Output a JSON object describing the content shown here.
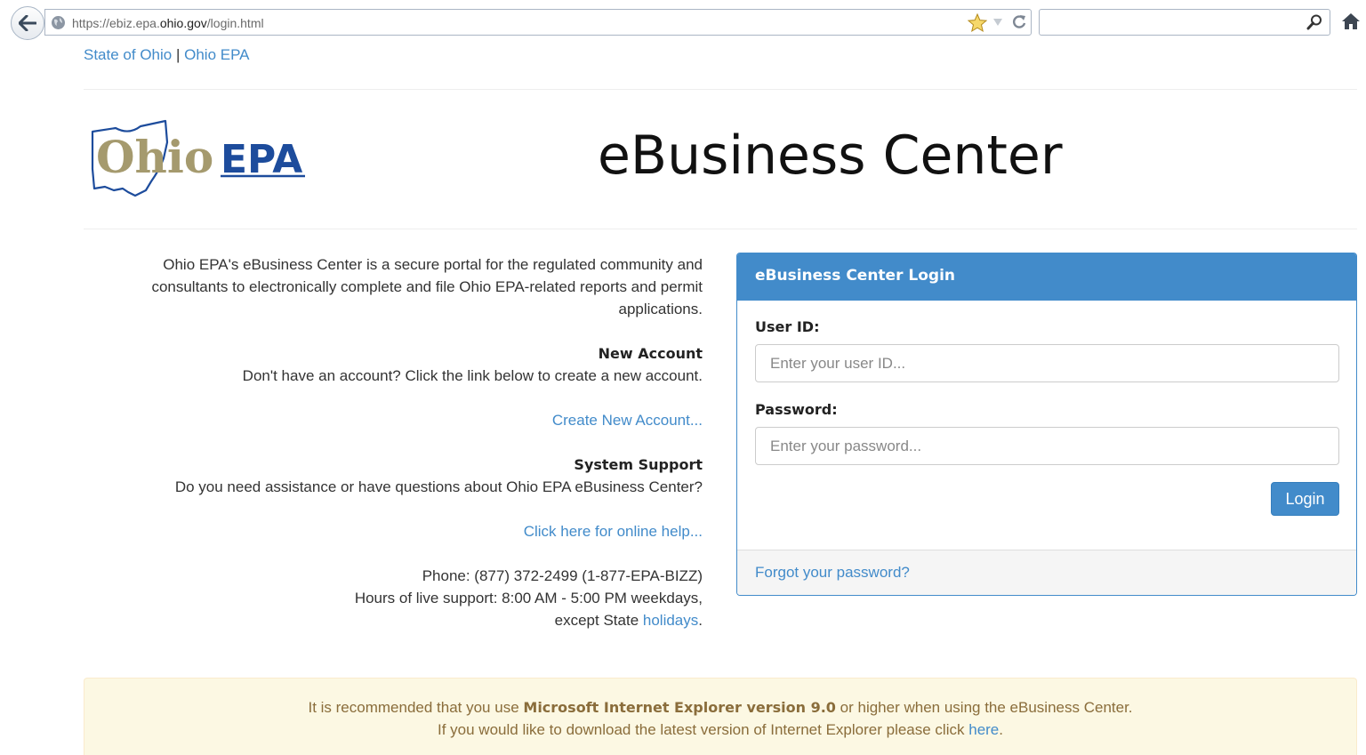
{
  "browser": {
    "url_prefix": "https://ebiz.epa.",
    "url_domain": "ohio.gov",
    "url_suffix": "/login.html"
  },
  "top_links": {
    "state_of_ohio": "State of Ohio",
    "separator": "|",
    "ohio_epa": "Ohio EPA"
  },
  "logo": {
    "text_ohio": "Ohio",
    "text_epa": "EPA",
    "colors": {
      "ohio_text": "#a59a6e",
      "epa_text": "#1d4c9c",
      "outline": "#1d4c9c"
    }
  },
  "header": {
    "title": "eBusiness Center"
  },
  "intro": {
    "description_line1": "Ohio EPA's eBusiness Center is a secure portal for the regulated community and",
    "description_line2": "consultants to electronically complete and file Ohio EPA-related reports and permit",
    "description_line3": "applications.",
    "new_account_heading": "New Account",
    "new_account_text": "Don't have an account? Click the link below to create a new account.",
    "create_account_link": "Create New Account...",
    "support_heading": "System Support",
    "support_text": "Do you need assistance or have questions about Ohio EPA eBusiness Center?",
    "online_help_link": "Click here for online help...",
    "phone": "Phone: (877) 372-2499 (1-877-EPA-BIZZ)",
    "hours": "Hours of live support: 8:00 AM - 5:00 PM weekdays,",
    "except_text": "except State",
    "holidays_link": "holidays",
    "period": "."
  },
  "login": {
    "panel_title": "eBusiness Center Login",
    "user_id_label": "User ID:",
    "user_id_placeholder": "Enter your user ID...",
    "password_label": "Password:",
    "password_placeholder": "Enter your password...",
    "login_button": "Login",
    "forgot_link": "Forgot your password?"
  },
  "notice": {
    "line1_prefix": "It is recommended that you use",
    "line1_bold": "Microsoft Internet Explorer version 9.0",
    "line1_suffix": "or higher when using the eBusiness Center.",
    "line2_prefix": "If you would like to download the latest version of Internet Explorer please click",
    "line2_link": "here",
    "line2_suffix": "."
  },
  "colors": {
    "primary": "#428bca",
    "alert_bg": "#fcf8e3",
    "alert_text": "#8a6d3b"
  }
}
